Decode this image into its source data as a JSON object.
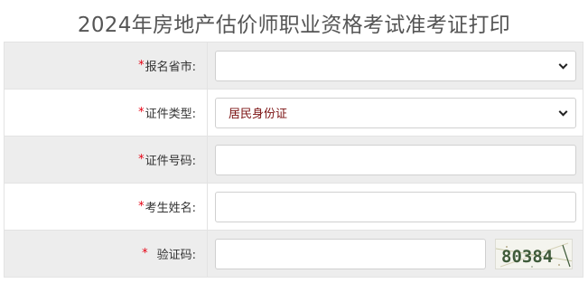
{
  "page": {
    "title": "2024年房地产估价师职业资格考试准考证打印"
  },
  "form": {
    "required_mark": "*",
    "province": {
      "label": "报名省市:",
      "value": ""
    },
    "id_type": {
      "label": "证件类型:",
      "value": "居民身份证"
    },
    "id_number": {
      "label": "证件号码:",
      "value": ""
    },
    "name": {
      "label": "考生姓名:",
      "value": ""
    },
    "captcha": {
      "label": "验证码:",
      "value": "",
      "image_text": "80384"
    }
  },
  "colors": {
    "required": "#e60012",
    "row_shaded": "#ededed",
    "select_text": "#7a1010"
  },
  "icons": {
    "dropdown": "chevron-down-icon"
  }
}
